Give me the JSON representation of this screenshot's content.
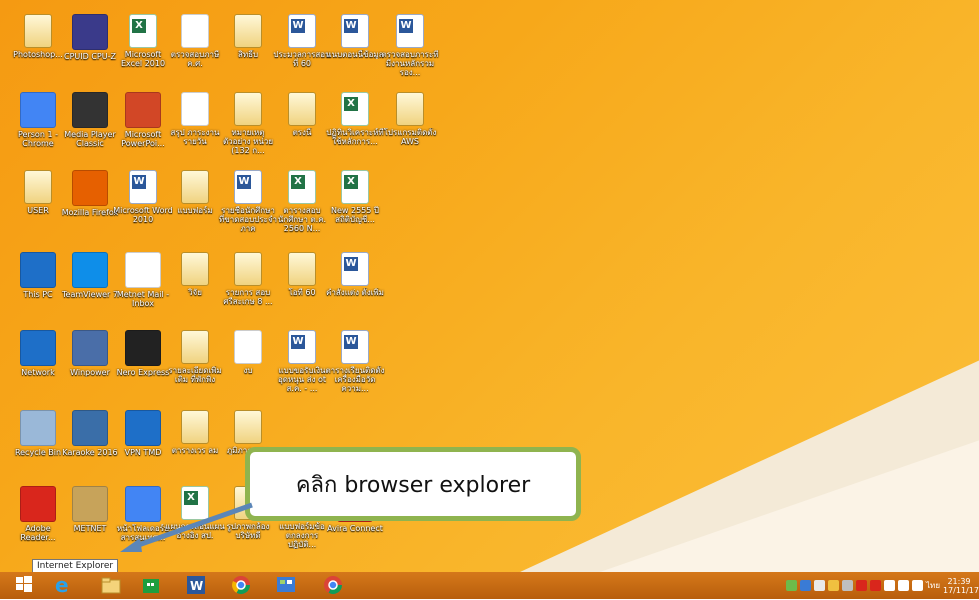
{
  "desktop_icons": [
    {
      "label": "Photoshop...",
      "icon": "folder-icon",
      "color": "#f4e3a2"
    },
    {
      "label": "CPUID CPU-Z",
      "icon": "cpu-z-icon",
      "color": "#3a3a8a"
    },
    {
      "label": "Microsoft Excel 2010",
      "icon": "excel-icon",
      "color": "#217346"
    },
    {
      "label": "ตรวจสอบภาษี ค.ศ.",
      "icon": "document-icon",
      "color": "#ffffff"
    },
    {
      "label": "สิทธิ์บ",
      "icon": "folder-icon",
      "color": "#f4e3a2"
    },
    {
      "label": "ประมวลการสอน ที่ 60",
      "icon": "word-icon",
      "color": "#2b579a"
    },
    {
      "label": "แนบตอนนี้ข้อมูล",
      "icon": "word-icon",
      "color": "#2b579a"
    },
    {
      "label": "ตรวจสอบภาระที่มีงานหลักรวมรอง...",
      "icon": "word-icon",
      "color": "#2b579a"
    },
    {
      "label": "Person 1 - Chrome",
      "icon": "chrome-icon",
      "color": "#4285f4"
    },
    {
      "label": "Media Player Classic",
      "icon": "media-player-icon",
      "color": "#333333"
    },
    {
      "label": "Microsoft PowerPoi...",
      "icon": "powerpoint-icon",
      "color": "#d24726"
    },
    {
      "label": "สรุป ภาระงาน รายวัน",
      "icon": "document-icon",
      "color": "#ffffff"
    },
    {
      "label": "หมายเหตุตัวอย่าง หน่วย (132 ก...",
      "icon": "folder-icon",
      "color": "#f4e3a2"
    },
    {
      "label": "ตรงนี้",
      "icon": "folder-icon",
      "color": "#f4e3a2"
    },
    {
      "label": "ปฏิทินวิเคราะห์ที่ ใช้หลักการ...",
      "icon": "excel-icon",
      "color": "#217346"
    },
    {
      "label": "โปรแกรมติดตั้ง AWS",
      "icon": "folder-icon",
      "color": "#f4e3a2"
    },
    {
      "label": "USER",
      "icon": "user-folder-icon",
      "color": "#f4e3a2"
    },
    {
      "label": "Mozilla Firefox",
      "icon": "firefox-icon",
      "color": "#e66000"
    },
    {
      "label": "Microsoft Word 2010",
      "icon": "word-icon",
      "color": "#2b579a"
    },
    {
      "label": "แบบฟอร์ม",
      "icon": "folder-icon",
      "color": "#f4e3a2"
    },
    {
      "label": "รายชื่อนักศึกษา ที่ขาดสอบประจำภาค",
      "icon": "word-icon",
      "color": "#2b579a"
    },
    {
      "label": "ตารางสอบนักศึกษา ต.ค. 2560 N...",
      "icon": "excel-icon",
      "color": "#217346"
    },
    {
      "label": "New 2555 ปีสถิติบัญชี...",
      "icon": "excel-icon",
      "color": "#217346"
    },
    {
      "label": "This PC",
      "icon": "this-pc-icon",
      "color": "#1e6fc8"
    },
    {
      "label": "TeamViewer 7",
      "icon": "teamviewer-icon",
      "color": "#0e8ee9"
    },
    {
      "label": "Metnet Mail - Inbox",
      "icon": "metnet-mail-icon",
      "color": "#ffffff"
    },
    {
      "label": "วิจัย",
      "icon": "folder-icon",
      "color": "#f4e3a2"
    },
    {
      "label": "รายการ สอบ ศรีสะเกษ 8 ...",
      "icon": "folder-icon",
      "color": "#f4e3a2"
    },
    {
      "label": "โอที 60",
      "icon": "folder-icon",
      "color": "#f4e3a2"
    },
    {
      "label": "คำสั่งแต่ง ตั้งเพิ่ม",
      "icon": "word-icon",
      "color": "#2b579a"
    },
    {
      "label": "Network",
      "icon": "network-icon",
      "color": "#1e6fc8"
    },
    {
      "label": "Winpower",
      "icon": "winpower-icon",
      "color": "#4a6ea8"
    },
    {
      "label": "Nero Express",
      "icon": "nero-express-icon",
      "color": "#222222"
    },
    {
      "label": "รายละเอียดเพิ่มเติม ที่พักพิง",
      "icon": "folder-icon",
      "color": "#f4e3a2"
    },
    {
      "label": "งบ",
      "icon": "document-icon",
      "color": "#ffffff"
    },
    {
      "label": "แบบขอรับเงินอุดหนุน ส่ง ot ส.ค. - ...",
      "icon": "word-icon",
      "color": "#2b579a"
    },
    {
      "label": "ตารางเรียนติดตั้ง เครื่องมือวัดความ...",
      "icon": "word-icon",
      "color": "#2b579a"
    },
    {
      "label": "Recycle Bin",
      "icon": "recycle-bin-icon",
      "color": "#9ab8d8"
    },
    {
      "label": "Karaoke 2016",
      "icon": "karaoke-icon",
      "color": "#3a6ea8"
    },
    {
      "label": "VPN TMD",
      "icon": "vpn-icon",
      "color": "#1e6fc8"
    },
    {
      "label": "ตารางเวร ลม",
      "icon": "folder-icon",
      "color": "#f4e3a2"
    },
    {
      "label": "ภูมิภาค พอง",
      "icon": "folder-icon",
      "color": "#f4e3a2"
    },
    {
      "label": "Adobe Reader...",
      "icon": "adobe-reader-icon",
      "color": "#d9261c"
    },
    {
      "label": "METNET",
      "icon": "metnet-icon",
      "color": "#c7a35a"
    },
    {
      "label": "หน้าโฟลเดอร์บ สารสนเทศ...",
      "icon": "chrome-icon",
      "color": "#4285f4"
    },
    {
      "label": "แผนการสอนแผน อ้างอิง สป.",
      "icon": "excel-icon",
      "color": "#217346"
    },
    {
      "label": "รูปภาพกล้อง บริษัทดี",
      "icon": "folder-icon",
      "color": "#f4e3a2"
    },
    {
      "label": "แบบฟอร์มข้อ ตกลงการปฏิบัติ...",
      "icon": "document-icon",
      "color": "#ffffff"
    },
    {
      "label": "Avira Connect",
      "icon": "avira-icon",
      "color": "#d9261c"
    }
  ],
  "callout": {
    "text": "คลิก browser explorer"
  },
  "tooltip": {
    "text": "Internet Explorer"
  },
  "taskbar": {
    "items": [
      {
        "name": "start-button",
        "icon": "windows-logo-icon"
      },
      {
        "name": "internet-explorer-button",
        "icon": "internet-explorer-icon"
      },
      {
        "name": "file-explorer-button",
        "icon": "file-explorer-icon"
      },
      {
        "name": "store-button",
        "icon": "store-icon"
      },
      {
        "name": "word-button",
        "icon": "word-icon"
      },
      {
        "name": "chrome-button",
        "icon": "chrome-icon"
      },
      {
        "name": "control-panel-button",
        "icon": "control-panel-icon"
      },
      {
        "name": "chrome-profile-button",
        "icon": "chrome-icon"
      }
    ],
    "clock": {
      "time": "21:39",
      "date": "17/11/17"
    },
    "language": "ไทย"
  }
}
